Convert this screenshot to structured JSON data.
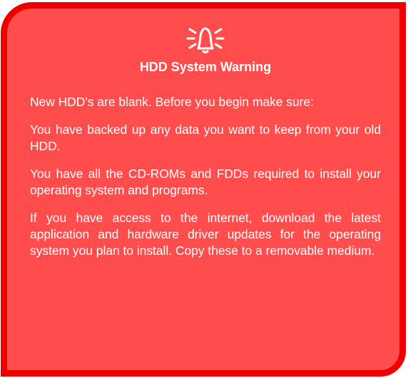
{
  "notice": {
    "icon": "bell-warning-icon",
    "title": "HDD System Warning",
    "paragraphs": [
      "New HDD’s are blank. Before you begin make sure:",
      "You have backed up any data you want to keep from your old HDD.",
      "You have all the CD-ROMs and FDDs required to install your operating system and programs.",
      "If you have access to the internet, download the latest application and hardware driver updates for the operating system you plan to install. Copy these to a removable medium."
    ]
  },
  "colors": {
    "background": "#ff4d4d",
    "border": "#ee0000",
    "text": "#ffffff"
  }
}
